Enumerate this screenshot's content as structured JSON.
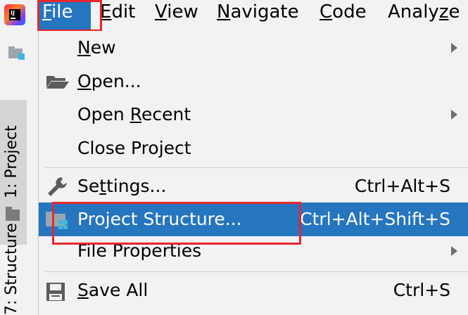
{
  "menubar": {
    "items": [
      {
        "pre": "",
        "mn": "F",
        "post": "ile"
      },
      {
        "pre": "",
        "mn": "E",
        "post": "dit"
      },
      {
        "pre": "",
        "mn": "V",
        "post": "iew"
      },
      {
        "pre": "",
        "mn": "N",
        "post": "avigate"
      },
      {
        "pre": "",
        "mn": "C",
        "post": "ode"
      },
      {
        "pre": "Analy",
        "mn": "z",
        "post": "e"
      }
    ]
  },
  "toolstrip": {
    "project_tab": "1: Project",
    "structure_tab": "7: Structure"
  },
  "file_menu": {
    "new": {
      "pre": "",
      "mn": "N",
      "post": "ew"
    },
    "open": {
      "pre": "",
      "mn": "O",
      "post": "pen..."
    },
    "open_recent": {
      "pre": "Open ",
      "mn": "R",
      "post": "ecent"
    },
    "close_project": "Close Project",
    "settings": {
      "pre": "Se",
      "mn": "t",
      "post": "tings...",
      "shortcut": "Ctrl+Alt+S"
    },
    "project_structure": {
      "label": "Project Structure...",
      "shortcut": "Ctrl+Alt+Shift+S"
    },
    "file_properties": "File Properties",
    "save_all": {
      "pre": "",
      "mn": "S",
      "post": "ave All",
      "shortcut": "Ctrl+S"
    }
  },
  "colors": {
    "highlight": "#2675bf",
    "annotation_red": "#e8262d"
  }
}
